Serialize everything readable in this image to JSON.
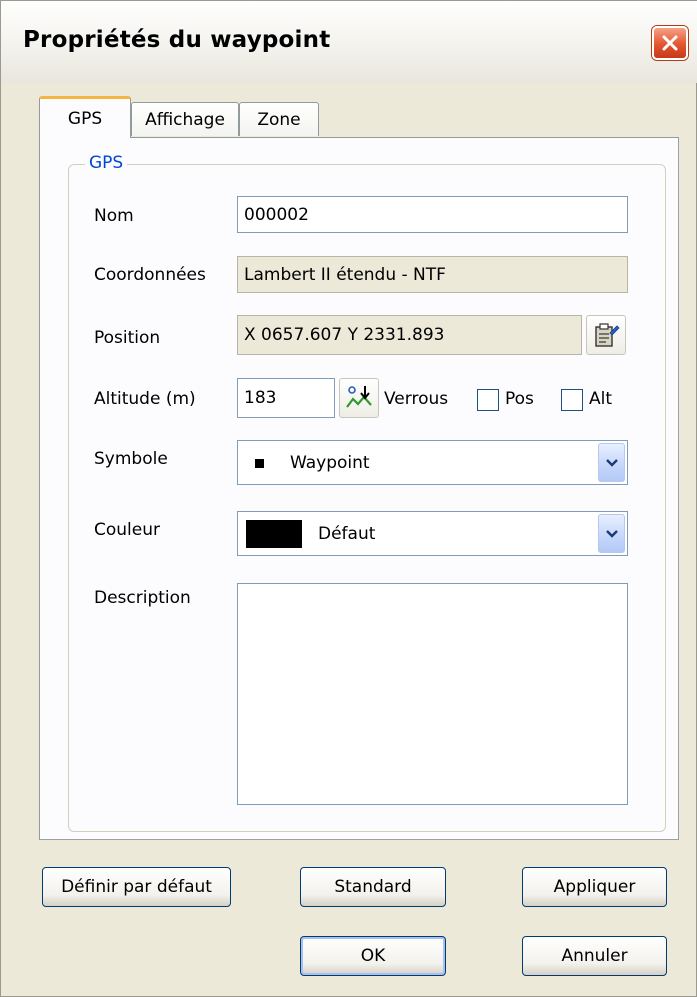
{
  "window": {
    "title": "Propriétés du waypoint"
  },
  "tabs": [
    {
      "label": "GPS",
      "active": true
    },
    {
      "label": "Affichage",
      "active": false
    },
    {
      "label": "Zone",
      "active": false
    }
  ],
  "group": {
    "legend": "GPS"
  },
  "form": {
    "nom_label": "Nom",
    "nom_value": "000002",
    "coord_label": "Coordonnées",
    "coord_value": "Lambert II étendu - NTF",
    "position_label": "Position",
    "position_value": "X 0657.607  Y 2331.893",
    "altitude_label": "Altitude (m)",
    "altitude_value": "183",
    "verrous_label": "Verrous",
    "pos_label": "Pos",
    "pos_checked": false,
    "alt_label": "Alt",
    "alt_checked": false,
    "symbole_label": "Symbole",
    "symbole_value": "Waypoint",
    "couleur_label": "Couleur",
    "couleur_value": "Défaut",
    "couleur_swatch": "#000000",
    "description_label": "Description",
    "description_value": ""
  },
  "buttons": {
    "definir": "Définir par défaut",
    "standard": "Standard",
    "appliquer": "Appliquer",
    "ok": "OK",
    "annuler": "Annuler"
  },
  "colors": {
    "accent_tab": "#f5b542",
    "legend_blue": "#0046d5",
    "close_red": "#e2562f"
  }
}
